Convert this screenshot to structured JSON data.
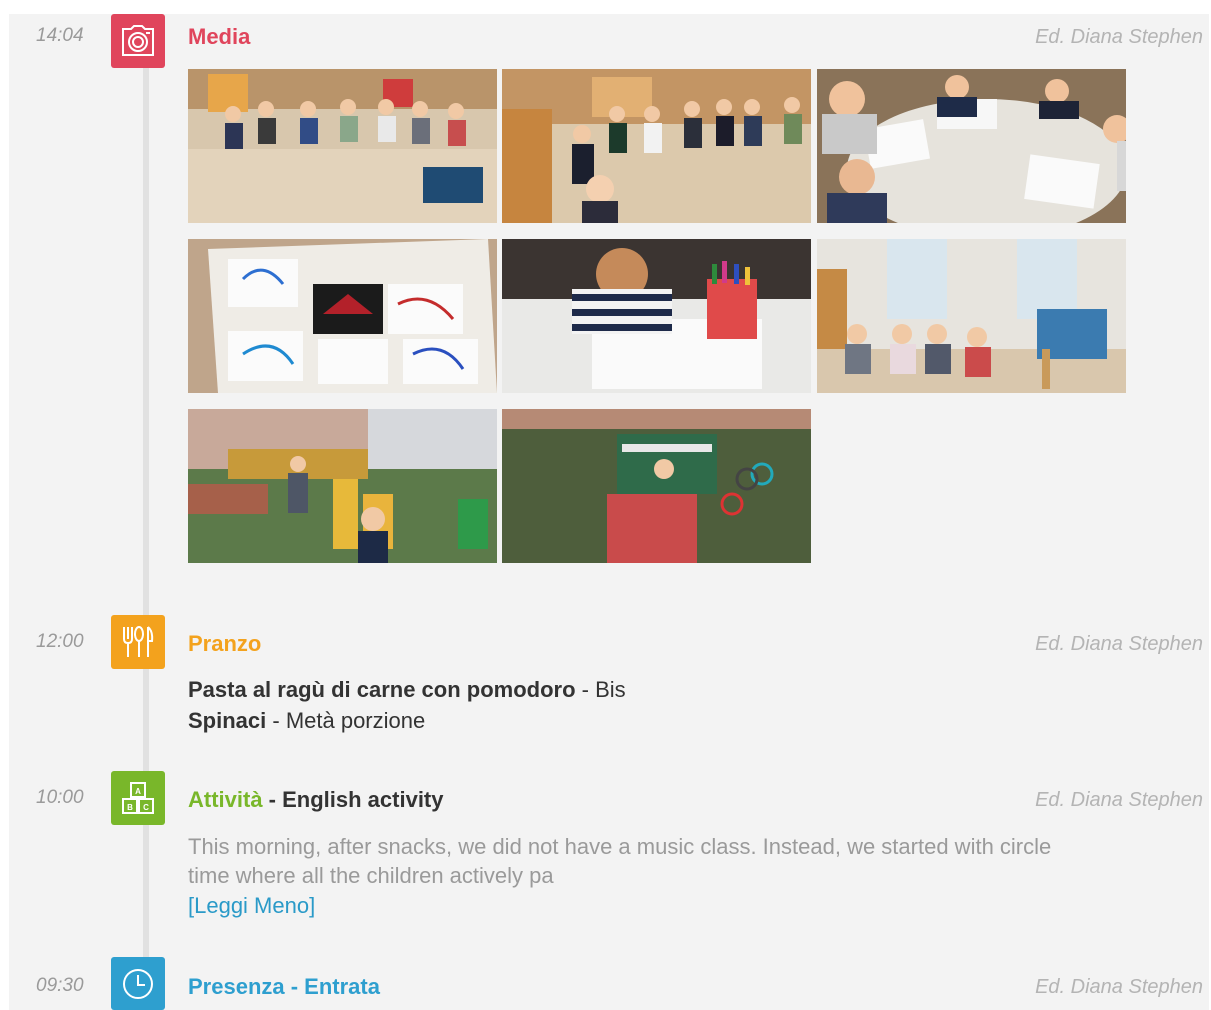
{
  "entries": {
    "media": {
      "time": "14:04",
      "title": "Media",
      "author": "Ed. Diana Stephen",
      "color": "#e0455c",
      "icon": "camera-icon"
    },
    "lunch": {
      "time": "12:00",
      "title": "Pranzo",
      "author": "Ed. Diana Stephen",
      "color": "#f3a21d",
      "icon": "utensils-icon",
      "items": [
        {
          "dish": "Pasta al ragù di carne con pomodoro",
          "sep": " - ",
          "portion": "Bis"
        },
        {
          "dish": "Spinaci",
          "sep": " - ",
          "portion": "Metà porzione"
        }
      ]
    },
    "activity": {
      "time": "10:00",
      "title": "Attività",
      "subtitle": " - English activity",
      "author": "Ed. Diana Stephen",
      "color": "#79b72a",
      "icon": "abc-blocks-icon",
      "description_line1": "This morning, after snacks, we did not have a music class. Instead, we started with circle",
      "description_line2": "time where all the children actively pa",
      "read_less": "[Leggi Meno]"
    },
    "attendance": {
      "time": "09:30",
      "title": "Presenza - Entrata",
      "author": "Ed. Diana Stephen",
      "color": "#2e9fcf",
      "icon": "clock-icon"
    }
  }
}
